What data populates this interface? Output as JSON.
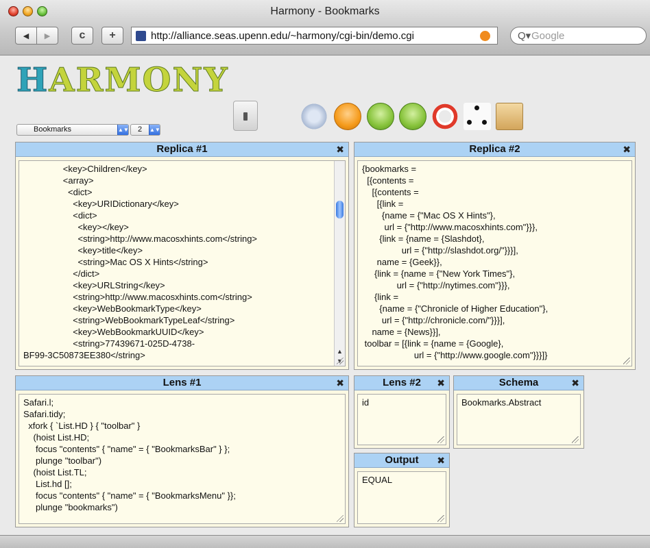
{
  "window": {
    "title": "Harmony - Bookmarks"
  },
  "toolbar": {
    "back_label": "◀",
    "forward_label": "▶",
    "reload_label": "c",
    "add_label": "+",
    "url": "http://alliance.seas.upenn.edu/~harmony/cgi-bin/demo.cgi",
    "search_placeholder": "Google",
    "search_glass": "Q▾"
  },
  "app": {
    "logo": "ARMONY",
    "logo_initial": "H",
    "demo_select": "Bookmarks",
    "number_select": "2"
  },
  "panes": {
    "replica1": {
      "title": "Replica #1",
      "text": "                <key>Children</key>\n                <array>\n                  <dict>\n                    <key>URIDictionary</key>\n                    <dict>\n                      <key></key>\n                      <string>http://www.macosxhints.com</string>\n                      <key>title</key>\n                      <string>Mac OS X Hints</string>\n                    </dict>\n                    <key>URLString</key>\n                    <string>http://www.macosxhints.com</string>\n                    <key>WebBookmarkType</key>\n                    <string>WebBookmarkTypeLeaf</string>\n                    <key>WebBookmarkUUID</key>\n                    <string>77439671-025D-4738-\nBF99-3C50873EE380</string>"
    },
    "replica2": {
      "title": "Replica #2",
      "text": "{bookmarks =\n  [{contents =\n    [{contents =\n      [{link =\n        {name = {\"Mac OS X Hints\"},\n         url = {\"http://www.macosxhints.com\"}}},\n       {link = {name = {Slashdot},\n                url = {\"http://slashdot.org/\"}}}],\n      name = {Geek}},\n     {link = {name = {\"New York Times\"},\n              url = {\"http://nytimes.com\"}}},\n     {link =\n       {name = {\"Chronicle of Higher Education\"},\n        url = {\"http://chronicle.com/\"}}}],\n    name = {News}}],\n toolbar = [{link = {name = {Google},\n                     url = {\"http://www.google.com\"}}}]}"
    },
    "lens1": {
      "title": "Lens #1",
      "text": "Safari.l;\nSafari.tidy;\n  xfork { `List.HD } { \"toolbar\" }\n    (hoist List.HD;\n     focus \"contents\" { \"name\" = { \"BookmarksBar\" } };\n     plunge \"toolbar\")\n    (hoist List.TL;\n     List.hd [];\n     focus \"contents\" { \"name\" = { \"BookmarksMenu\" }};\n     plunge \"bookmarks\")"
    },
    "lens2": {
      "title": "Lens #2",
      "text": "id"
    },
    "schema": {
      "title": "Schema",
      "text": "Bookmarks.Abstract"
    },
    "output": {
      "title": "Output",
      "text": "EQUAL"
    }
  },
  "close_glyph": "✖",
  "colors": {
    "pane_header": "#acd2f4",
    "pane_bg": "#fbf8e2"
  }
}
